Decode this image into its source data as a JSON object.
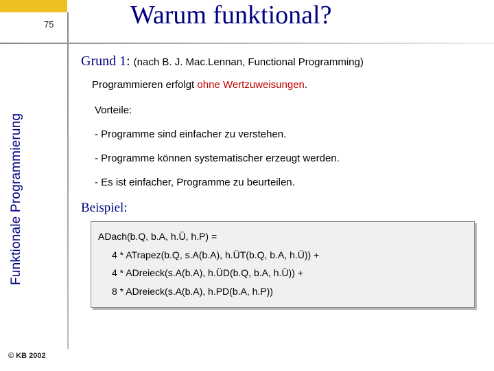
{
  "slide_number": "75",
  "title": "Warum funktional?",
  "sidebar_label": "Funktionale Programmierung",
  "copyright": "© KB 2002",
  "grund": {
    "heading": "Grund 1:",
    "ref": "(nach B. J. Mac.Lennan, Functional Programming)"
  },
  "subhead": {
    "prefix": "Programmieren erfolgt ",
    "highlight": "ohne Wertzuweisungen",
    "suffix": "."
  },
  "vorteile": {
    "label": "Vorteile:",
    "items": [
      "- Programme sind einfacher zu verstehen.",
      "- Programme können systematischer erzeugt werden.",
      "- Es ist einfacher, Programme zu beurteilen."
    ]
  },
  "beispiel_label": "Beispiel:",
  "code": {
    "l1": "ADach(b.Q, b.A, h.Ü, h.P) =",
    "l2": "4 * ATrapez(b.Q, s.A(b.A), h.ÜT(b.Q, b.A, h.Ü)) +",
    "l3": "4 * ADreieck(s.A(b.A), h.ÜD(b.Q, b.A, h.Ü)) +",
    "l4": "8 * ADreieck(s.A(b.A), h.PD(b.A, h.P))"
  }
}
